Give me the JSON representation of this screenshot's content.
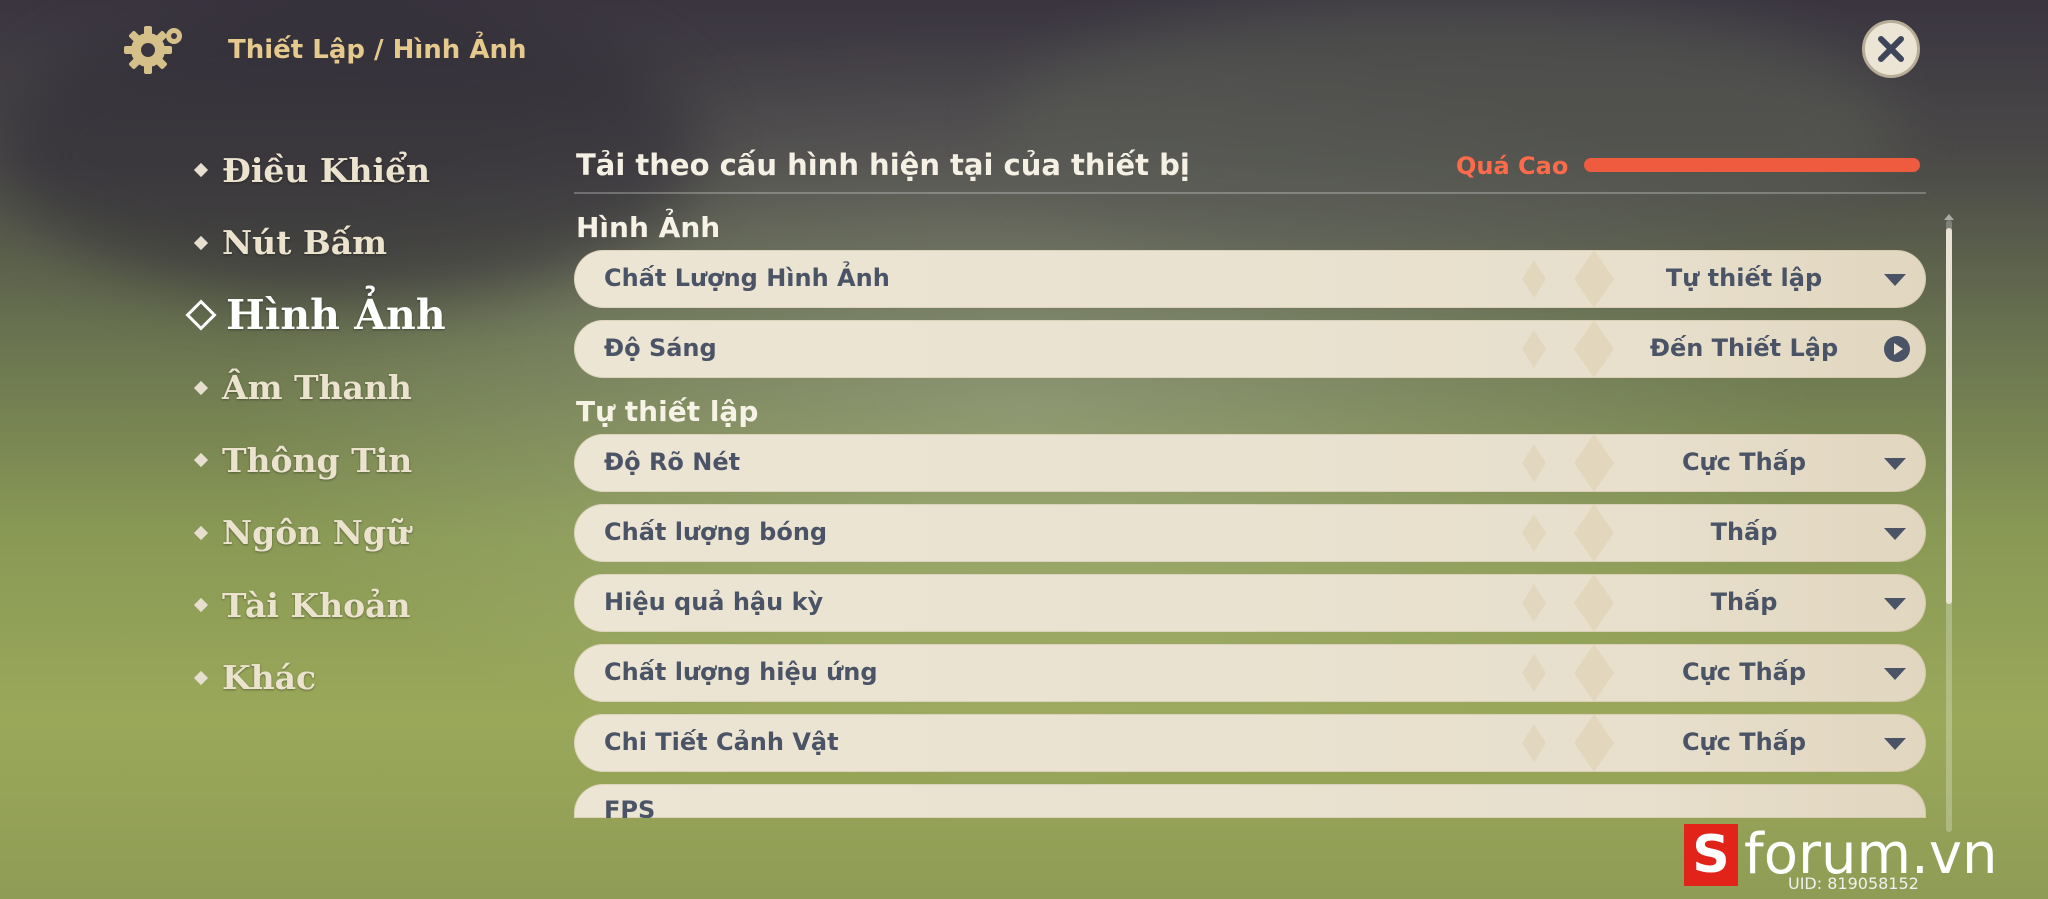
{
  "header": {
    "breadcrumb": "Thiết Lập / Hình Ảnh",
    "icon": "gear-icon",
    "close_icon": "close-icon"
  },
  "sidebar": {
    "items": [
      {
        "label": "Điều Khiển"
      },
      {
        "label": "Nút Bấm"
      },
      {
        "label": "Hình Ảnh",
        "active": true
      },
      {
        "label": "Âm Thanh"
      },
      {
        "label": "Thông Tin"
      },
      {
        "label": "Ngôn Ngữ"
      },
      {
        "label": "Tài Khoản"
      },
      {
        "label": "Khác"
      }
    ]
  },
  "main": {
    "device_text": "Tải theo cấu hình hiện tại của thiết bị",
    "quality_label": "Quá Cao",
    "quality_level": 1.0,
    "sections": [
      {
        "title": "Hình Ảnh",
        "rows": [
          {
            "name": "Chất Lượng Hình Ảnh",
            "value": "Tự thiết lập",
            "control": "dropdown"
          },
          {
            "name": "Độ Sáng",
            "value": "Đến Thiết Lập",
            "control": "go"
          }
        ]
      },
      {
        "title": "Tự thiết lập",
        "rows": [
          {
            "name": "Độ Rõ Nét",
            "value": "Cực Thấp",
            "control": "dropdown"
          },
          {
            "name": "Chất lượng bóng",
            "value": "Thấp",
            "control": "dropdown"
          },
          {
            "name": "Hiệu quả hậu kỳ",
            "value": "Thấp",
            "control": "dropdown"
          },
          {
            "name": "Chất lượng hiệu ứng",
            "value": "Cực Thấp",
            "control": "dropdown"
          },
          {
            "name": "Chi Tiết Cảnh Vật",
            "value": "Cực Thấp",
            "control": "dropdown"
          },
          {
            "name": "FPS",
            "value": "",
            "control": "dropdown"
          }
        ]
      }
    ]
  },
  "watermark": {
    "logo_letter": "S",
    "text": "forum.vn"
  },
  "uid": "UID: 819058152",
  "colors": {
    "accent": "#e6c98c",
    "warning": "#ef5b3f",
    "row_bg": "#ece5d4",
    "row_text": "#4b5466"
  }
}
